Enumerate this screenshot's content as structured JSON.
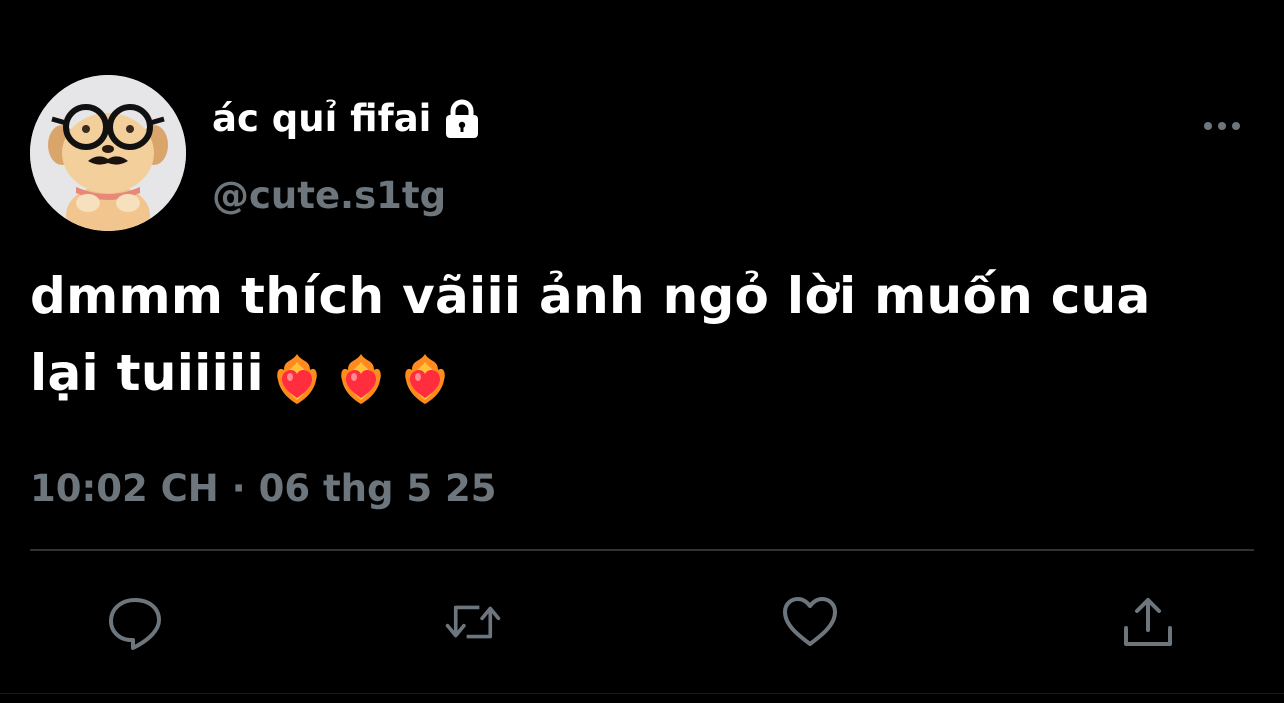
{
  "tweet": {
    "display_name": "ác quỉ fifai",
    "handle": "@cute.s1tg",
    "text_line1": "dmmm thích vãiii ảnh ngỏ lời muốn cua",
    "text_line2": "lại tuiiiii",
    "emojis": [
      "heart-on-fire",
      "heart-on-fire",
      "heart-on-fire"
    ],
    "meta": "10:02 CH · 06 thg 5 25",
    "icons": {
      "lock": "lock-icon",
      "more": "more-icon",
      "reply": "reply-icon",
      "retweet": "retweet-icon",
      "like": "heart-icon",
      "share": "share-icon"
    }
  },
  "colors": {
    "background": "#000000",
    "text": "#ffffff",
    "secondary": "#6e767d",
    "divider": "#2f3336"
  }
}
